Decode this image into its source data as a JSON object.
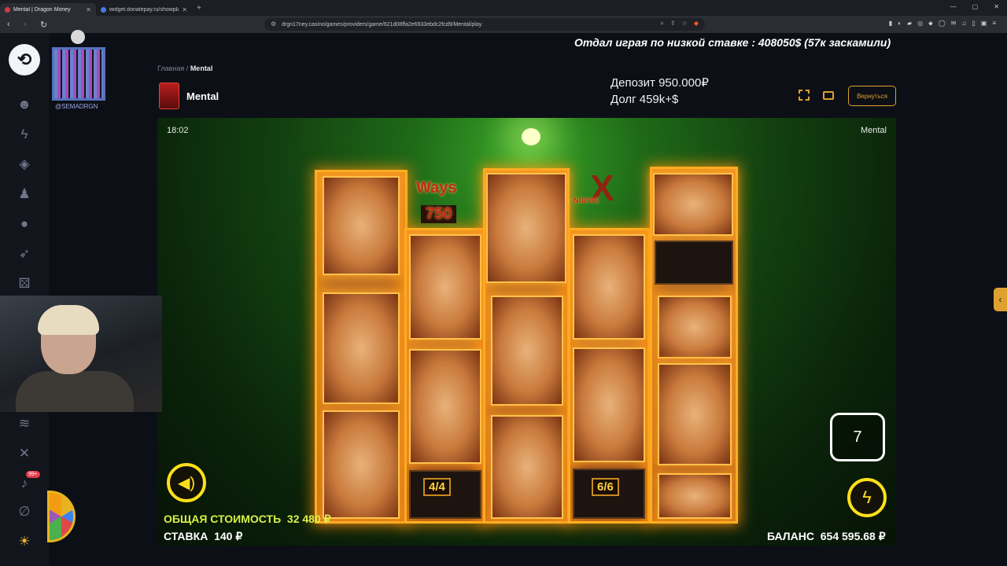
{
  "browser": {
    "tabs": [
      {
        "title": "Mental | Dragon Money",
        "active": true
      },
      {
        "title": "widget.donatepay.ru/showplayer...",
        "active": false
      }
    ],
    "url": "drgn17ney.casino/games/providers/game/621d08ffa2e6933ebdc2fcd9/Mental/play"
  },
  "stream_overlay": {
    "notice": "Отдал играя по низкой ставке : 408050$ (57к заскамили)",
    "deposit": "Депозит 950.000₽",
    "debt": "Долг  459k+$",
    "qr_handle": "@SEMADRGN"
  },
  "sidebar": {
    "icons": [
      "logo-icon",
      "bear-icon",
      "lightning-icon",
      "crystal-icon",
      "person-icon",
      "bomb-icon",
      "rocket-icon",
      "dice-icon",
      "vk-icon",
      "x-icon",
      "bell-icon",
      "mute-icon",
      "sun-icon"
    ],
    "notification_count": "99+"
  },
  "breadcrumb": {
    "home": "Главная",
    "sep": "/",
    "current": "Mental"
  },
  "game": {
    "title": "Mental",
    "back_button": "Вернуться",
    "clock": "18:02",
    "name_label": "Mental",
    "ways_label": "Ways",
    "ways_value": "750",
    "nudge_label": "NUDGE",
    "counter_1": "4/4",
    "counter_2": "6/6",
    "spins_left": "7",
    "total_cost_label": "ОБЩАЯ СТОИМОСТЬ",
    "total_cost_value": "32 480 ₽",
    "bet_label": "СТАВКА",
    "bet_value": "140 ₽",
    "balance_label": "БАЛАНС",
    "balance_value": "654 595.68 ₽"
  },
  "colors": {
    "accent": "#e0a030",
    "hud_yellow": "#d8f24a",
    "reel_fire": "#ffb020"
  }
}
